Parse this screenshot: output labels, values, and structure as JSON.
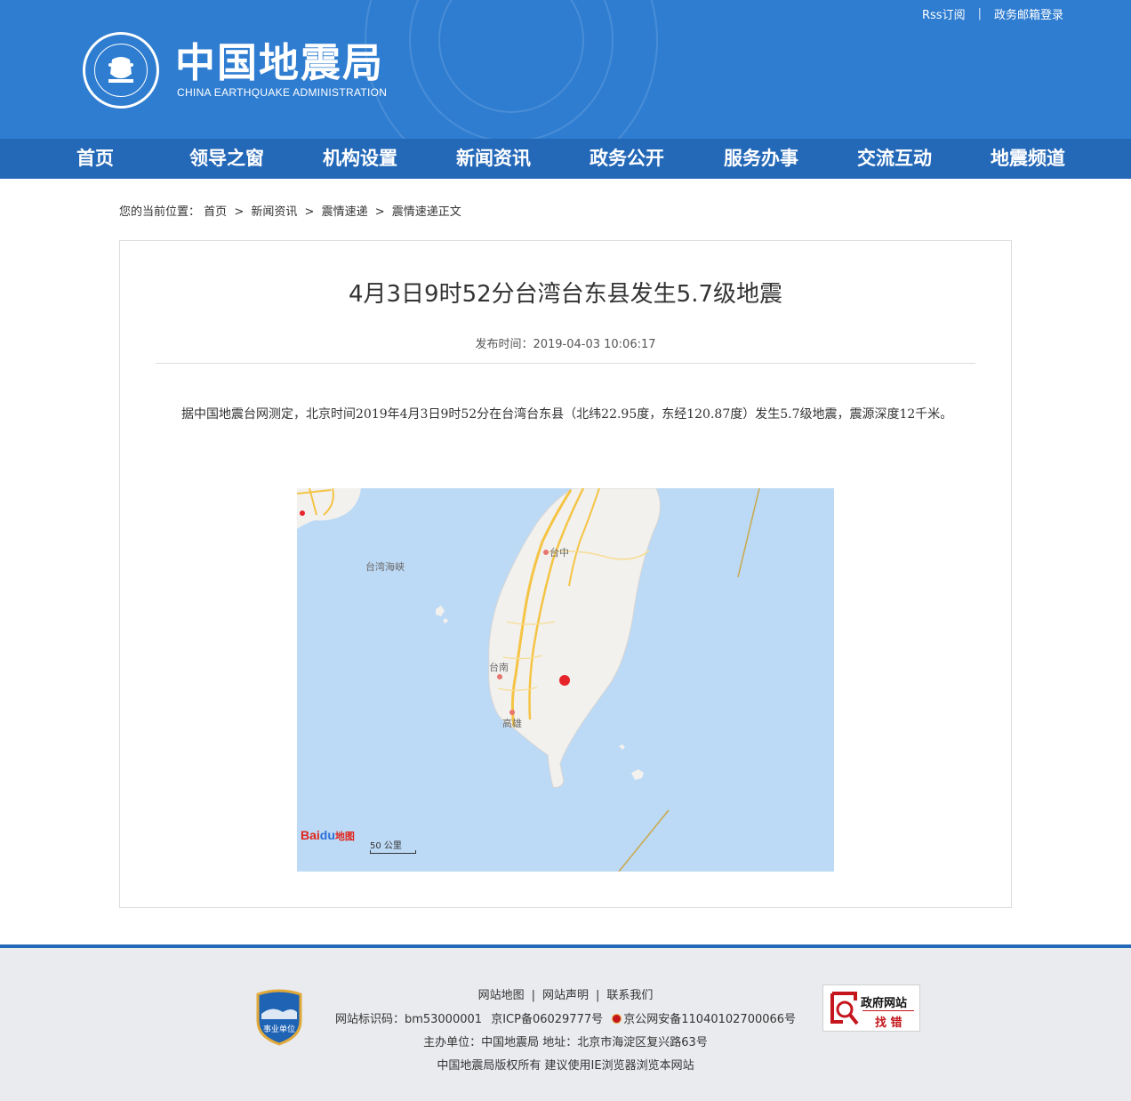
{
  "header": {
    "logo_cn": "中国地震局",
    "logo_en": "CHINA EARTHQUAKE ADMINISTRATION",
    "rss": "Rss订阅",
    "top_sep": "|",
    "mail_login": "政务邮箱登录"
  },
  "nav": [
    {
      "label": "首页"
    },
    {
      "label": "领导之窗"
    },
    {
      "label": "机构设置"
    },
    {
      "label": "新闻资讯"
    },
    {
      "label": "政务公开"
    },
    {
      "label": "服务办事"
    },
    {
      "label": "交流互动"
    },
    {
      "label": "地震频道"
    }
  ],
  "breadcrumb": {
    "prefix": "您的当前位置：",
    "items": [
      "首页",
      "新闻资讯",
      "震情速递",
      "震情速递正文"
    ],
    "sep": ">"
  },
  "article": {
    "title": "4月3日9时52分台湾台东县发生5.7级地震",
    "publish_time": "发布时间：2019-04-03 10:06:17",
    "body": "据中国地震台网测定，北京时间2019年4月3日9时52分在台湾台东县（北纬22.95度，东经120.87度）发生5.7级地震，震源深度12千米。"
  },
  "map": {
    "labels": {
      "strait": "台湾海峡",
      "taichung": "台中",
      "tainan": "台南",
      "kaohsiung": "高雄"
    },
    "baidu_part1": "Bai",
    "baidu_part2": "du",
    "baidu_part3": "地图",
    "scale": "50 公里",
    "epicenter_color": "#e8242b"
  },
  "footer": {
    "links": [
      "网站地图",
      "网站声明",
      "联系我们"
    ],
    "link_sep": "|",
    "line1_id": "网站标识码：bm53000001",
    "line1_icp": "京ICP备06029777号",
    "line1_police": "京公网安备11040102700066号",
    "line2": "主办单位：中国地震局   地址：北京市海淀区复兴路63号",
    "line3": "中国地震局版权所有   建议使用IE浏览器浏览本网站",
    "shield_text": "事业单位",
    "gov_badge_top": "政府网站",
    "gov_badge_bottom": "找 错"
  },
  "colors": {
    "header_bg": "#2f7dd1",
    "nav_bg": "#2468b8",
    "footer_bg": "#e9ebee",
    "sea": "#bcd9f5",
    "land": "#f2f1ee",
    "road": "#f5c445"
  }
}
